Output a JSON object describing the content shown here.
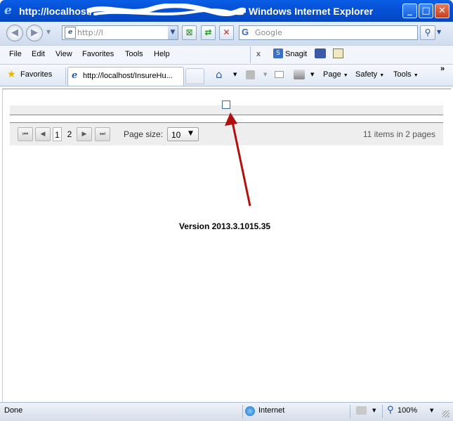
{
  "window": {
    "title": "http://localhost/",
    "title_suffix": "Windows Internet Explorer",
    "buttons": {
      "minimize": "_",
      "maximize": "□",
      "close": "✕"
    }
  },
  "address_bar": {
    "url": "http://l"
  },
  "search": {
    "placeholder": "Google"
  },
  "menu": {
    "items": [
      "File",
      "Edit",
      "View",
      "Favorites",
      "Tools",
      "Help"
    ],
    "snagit": "Snagit",
    "close_x": "x"
  },
  "favorites_bar": {
    "favorites_label": "Favorites",
    "tab_title": "http://localhost/InsureHu...",
    "commands": {
      "page": "Page",
      "safety": "Safety",
      "tools": "Tools"
    },
    "overflow": "»"
  },
  "pager": {
    "pages": [
      "1",
      "2"
    ],
    "current_page": "1",
    "page_size_label": "Page size:",
    "page_size_value": "10",
    "info": "11 items in 2 pages"
  },
  "version": "Version 2013.3.1015.35",
  "status_bar": {
    "status": "Done",
    "zone": "Internet",
    "zoom": "100%"
  },
  "colors": {
    "titlebar": "#0551d6",
    "annotation_arrow": "#b01010",
    "grid_background": "#eeeeee"
  }
}
